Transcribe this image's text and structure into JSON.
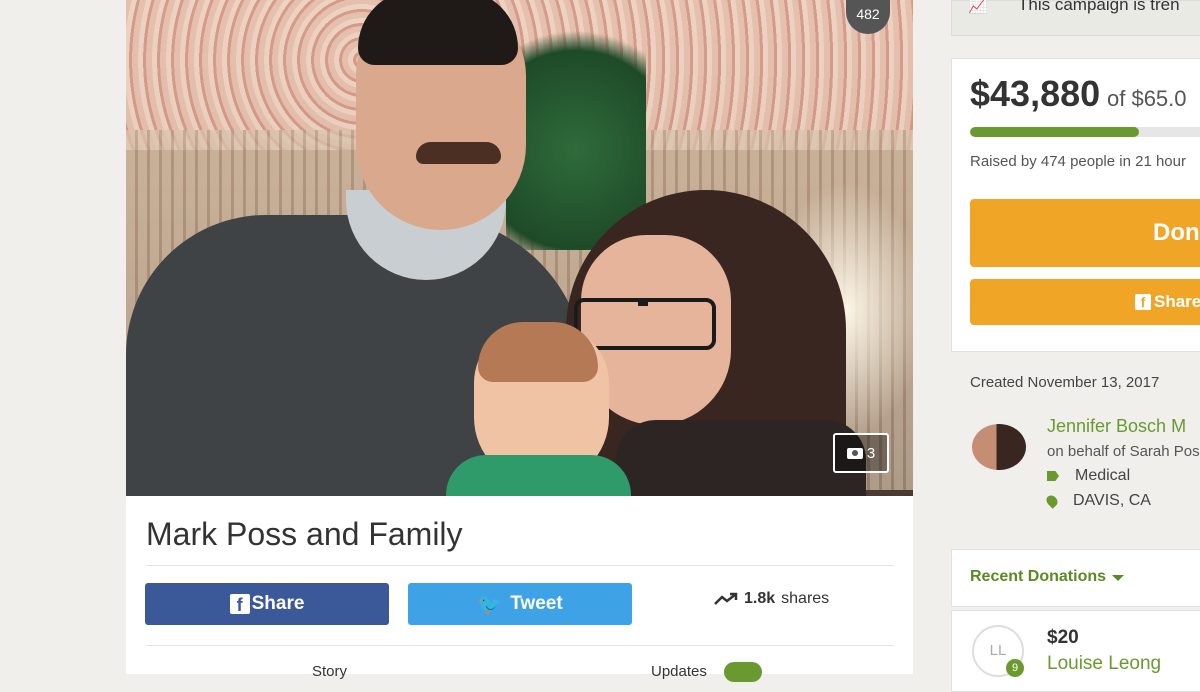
{
  "campaign": {
    "photo_likes": "482",
    "photo_count": "3",
    "title": "Mark Poss and Family",
    "share_label": "Share",
    "tweet_label": "Tweet",
    "shares_count": "1.8k",
    "shares_label": "shares",
    "tabs": [
      {
        "label": "Story"
      },
      {
        "label": "Updates",
        "badge": ""
      }
    ]
  },
  "sidebar": {
    "trending_text": "This campaign is tren",
    "raised_amount": "$43,880",
    "goal_text": "of $65.0",
    "progress_fraction": 0.675,
    "raised_by": "Raised by 474 people in 21 hour",
    "donate_label": "Don",
    "share_label": "Share",
    "created": "Created November 13, 2017",
    "organizer_name": "Jennifer Bosch M",
    "on_behalf": "on behalf of Sarah Pos",
    "category": "Medical",
    "location": "DAVIS, CA",
    "recent_donations_label": "Recent Donations",
    "donation": {
      "initials": "LL",
      "badge": "9",
      "amount": "$20",
      "name": "Louise Leong"
    }
  },
  "colors": {
    "green": "#6a9a2f",
    "orange": "#f0a527",
    "facebook": "#3b5998",
    "twitter": "#3ea2e6"
  }
}
